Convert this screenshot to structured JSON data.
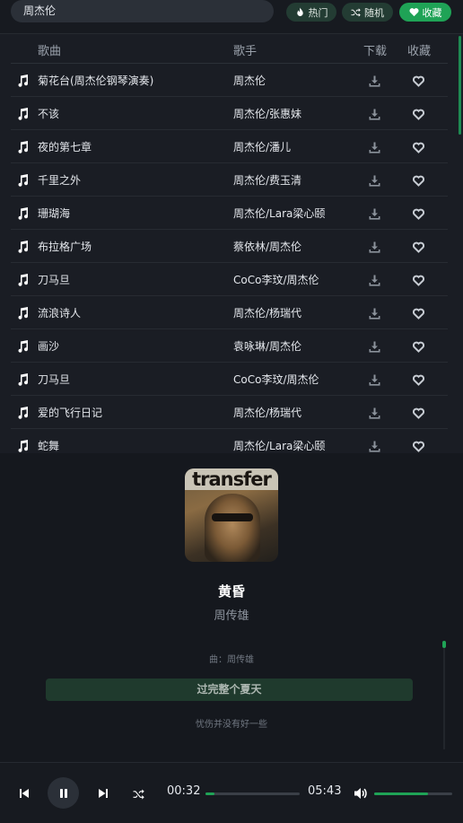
{
  "search": {
    "value": "周杰伦"
  },
  "filters": [
    {
      "label": "热门",
      "icon": "flame-icon"
    },
    {
      "label": "随机",
      "icon": "shuffle-icon"
    },
    {
      "label": "收藏",
      "icon": "heart-icon",
      "active": true
    }
  ],
  "table": {
    "headers": {
      "song": "歌曲",
      "artist": "歌手",
      "download": "下载",
      "favorite": "收藏"
    },
    "rows": [
      {
        "title": "菊花台(周杰伦钢琴演奏)",
        "artist": "周杰伦"
      },
      {
        "title": "不该",
        "artist": "周杰伦/张惠妹"
      },
      {
        "title": "夜的第七章",
        "artist": "周杰伦/潘儿"
      },
      {
        "title": "千里之外",
        "artist": "周杰伦/费玉清"
      },
      {
        "title": "珊瑚海",
        "artist": "周杰伦/Lara梁心颐"
      },
      {
        "title": "布拉格广场",
        "artist": "蔡依林/周杰伦"
      },
      {
        "title": "刀马旦",
        "artist": "CoCo李玟/周杰伦"
      },
      {
        "title": "流浪诗人",
        "artist": "周杰伦/杨瑞代"
      },
      {
        "title": "画沙",
        "artist": "袁咏琳/周杰伦"
      },
      {
        "title": "刀马旦",
        "artist": "CoCo李玟/周杰伦"
      },
      {
        "title": "爱的飞行日记",
        "artist": "周杰伦/杨瑞代"
      },
      {
        "title": "蛇舞",
        "artist": "周杰伦/Lara梁心颐"
      }
    ]
  },
  "now_playing": {
    "cover_text": "transfer",
    "title": "黄昏",
    "artist": "周传雄",
    "lyrics": {
      "credit": "曲：周传雄",
      "current": "过完整个夏天",
      "next": "忧伤并没有好一些"
    }
  },
  "player": {
    "current_time": "00:32",
    "duration": "05:43",
    "progress": 0.093,
    "volume": 0.69
  },
  "colors": {
    "accent": "#1fa356",
    "background": "#1a1d24",
    "panel": "#15181e"
  }
}
